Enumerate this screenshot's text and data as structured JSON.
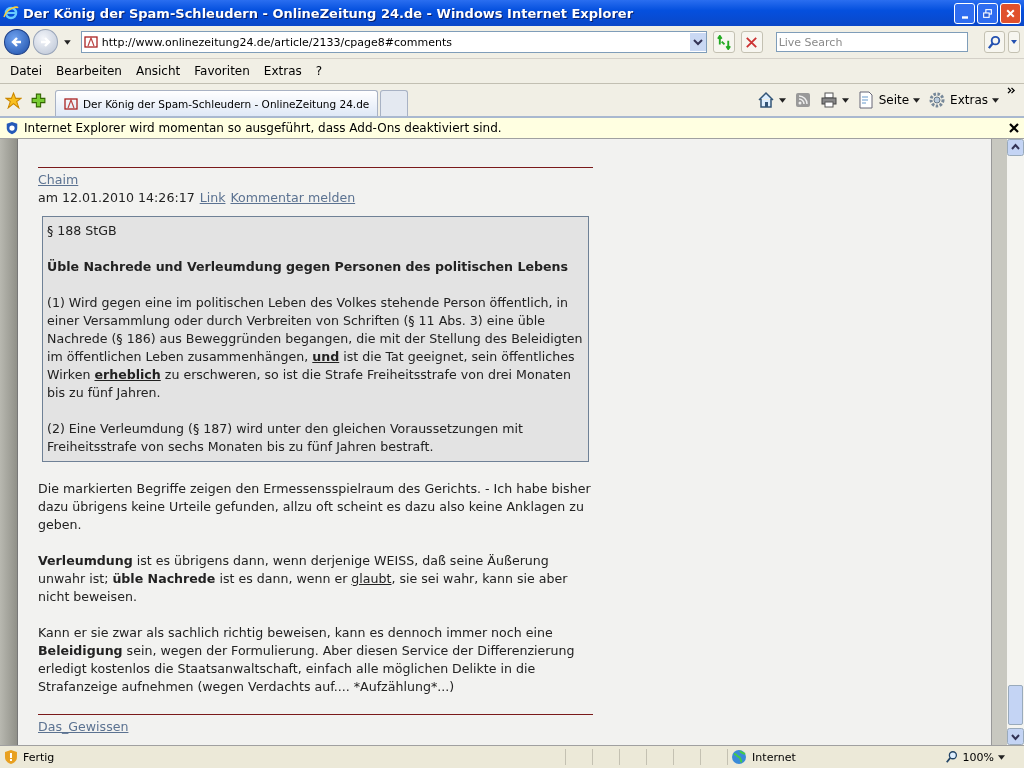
{
  "window": {
    "title": "Der König der Spam-Schleudern - OnlineZeitung 24.de - Windows Internet Explorer"
  },
  "address_bar": {
    "url": "http://www.onlinezeitung24.de/article/2133/cpage8#comments",
    "search_placeholder": "Live Search"
  },
  "menu": [
    "Datei",
    "Bearbeiten",
    "Ansicht",
    "Favoriten",
    "Extras",
    "?"
  ],
  "tabs": [
    {
      "label": "Der König der Spam-Schleudern - OnlineZeitung 24.de",
      "selected": true
    },
    {
      "selected": false
    }
  ],
  "command_bar": [
    {
      "kind": "home"
    },
    {
      "kind": "feeds"
    },
    {
      "kind": "print"
    },
    {
      "kind": "page",
      "label": "Seite"
    },
    {
      "kind": "tools",
      "label": "Extras"
    }
  ],
  "info_bar": {
    "text": "Internet Explorer wird momentan so ausgeführt, dass Add-Ons deaktiviert sind."
  },
  "comments": [
    {
      "author": "Chaim",
      "meta": "am 12.01.2010 14:26:17",
      "links": [
        "Link",
        "Kommentar melden"
      ],
      "quote": {
        "heading": "§ 188 StGB",
        "title": "Üble Nachrede und Verleumdung gegen Personen des politischen Lebens",
        "paragraphs": [
          [
            {
              "text": "(1) Wird gegen eine im politischen Leben des Volkes stehende Person öffentlich, in einer Versammlung oder durch Verbreiten von Schriften (§ 11 Abs. 3) eine üble Nachrede (§ 186) aus Beweggründen begangen, die mit der Stellung des Beleidigten im öffentlichen Leben zusammenhängen, ",
              "bold": false,
              "underline": false
            },
            {
              "text": "und",
              "bold": true,
              "underline": true
            },
            {
              "text": " ist die Tat geeignet, sein öffentliches Wirken ",
              "bold": false,
              "underline": false
            },
            {
              "text": "erheblich",
              "bold": true,
              "underline": true
            },
            {
              "text": " zu erschweren, so ist die Strafe Freiheitsstrafe von drei Monaten bis zu fünf Jahren.",
              "bold": false,
              "underline": false
            }
          ],
          [
            {
              "text": "(2) Eine Verleumdung (§ 187) wird unter den gleichen Voraussetzungen mit Freiheitsstrafe von sechs Monaten bis zu fünf Jahren bestraft.",
              "bold": false,
              "underline": false
            }
          ]
        ]
      },
      "paragraphs": [
        [
          {
            "text": "Die markierten Begriffe zeigen den Ermessensspielraum des Gerichts. - Ich habe bisher dazu übrigens keine Urteile gefunden, allzu oft scheint es dazu also keine Anklagen zu geben.",
            "bold": false,
            "underline": false
          }
        ],
        [
          {
            "text": "Verleumdung",
            "bold": true,
            "underline": false
          },
          {
            "text": " ist es übrigens dann, wenn derjenige WEISS, daß seine Äußerung unwahr ist; ",
            "bold": false,
            "underline": false
          },
          {
            "text": "üble Nachrede",
            "bold": true,
            "underline": false
          },
          {
            "text": " ist es dann, wenn er ",
            "bold": false,
            "underline": false
          },
          {
            "text": "glaubt",
            "bold": false,
            "underline": true
          },
          {
            "text": ", sie sei wahr, kann sie aber nicht beweisen.",
            "bold": false,
            "underline": false
          }
        ],
        [
          {
            "text": "Kann er sie zwar als sachlich richtig beweisen, kann es dennoch immer noch eine ",
            "bold": false,
            "underline": false
          },
          {
            "text": "Beleidigung",
            "bold": true,
            "underline": false
          },
          {
            "text": " sein, wegen der Formulierung. Aber diesen Service der Differenzierung erledigt kostenlos die Staatsanwaltschaft, einfach alle möglichen Delikte in die Strafanzeige aufnehmen (wegen Verdachts auf.... *Aufzählung*...)",
            "bold": false,
            "underline": false
          }
        ]
      ]
    },
    {
      "author": "Das_Gewissen"
    }
  ],
  "status_bar": {
    "status": "Fertig",
    "zone": "Internet",
    "zoom": "100%"
  }
}
